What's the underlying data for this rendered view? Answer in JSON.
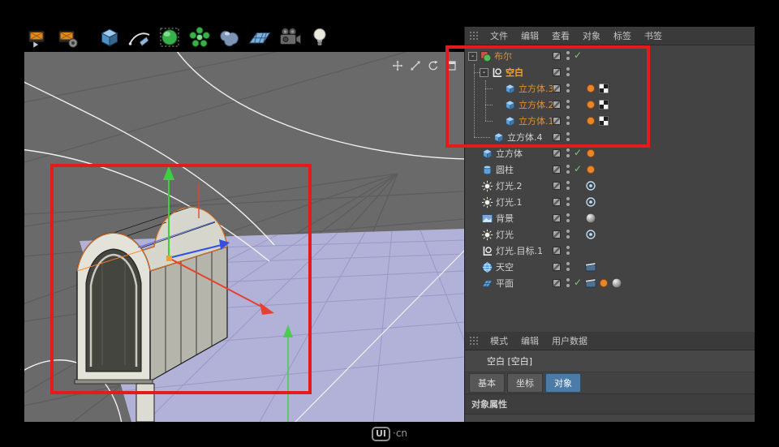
{
  "colors": {
    "annotation": "#e51b1b",
    "selected-orange": "#ffa21e",
    "object-orange": "#e0913c",
    "axis-x": "#e8402e",
    "axis-y": "#3ecf3e",
    "axis-z": "#3450e0",
    "floor-purple": "#b2b1d8",
    "tab-active": "#4d7ba8"
  },
  "toolbar": {
    "icons": [
      {
        "id": "render-view",
        "name": "render-view-icon",
        "glyph": "render1",
        "gap_after": false
      },
      {
        "id": "render-settings",
        "name": "render-settings-icon",
        "glyph": "render2",
        "gap_after": true
      },
      {
        "id": "cube",
        "name": "cube-tool-icon",
        "glyph": "cube",
        "gap_after": false
      },
      {
        "id": "pen",
        "name": "pen-tool-icon",
        "glyph": "pen",
        "gap_after": false
      },
      {
        "id": "subdivision",
        "name": "subdivision-surface-icon",
        "glyph": "subdiv",
        "gap_after": false
      },
      {
        "id": "array",
        "name": "array-tool-icon",
        "glyph": "array",
        "gap_after": false
      },
      {
        "id": "metaball",
        "name": "metaball-tool-icon",
        "glyph": "metaball",
        "gap_after": false
      },
      {
        "id": "floor",
        "name": "floor-tool-icon",
        "glyph": "floor",
        "gap_after": false
      },
      {
        "id": "camera",
        "name": "camera-tool-icon",
        "glyph": "camera",
        "gap_after": false
      },
      {
        "id": "light",
        "name": "light-tool-icon",
        "glyph": "bulb",
        "gap_after": false
      }
    ]
  },
  "viewport": {
    "controls": [
      {
        "id": "pan",
        "name": "pan-view-icon",
        "glyph": "pan"
      },
      {
        "id": "zoom",
        "name": "zoom-view-icon",
        "glyph": "zoom"
      },
      {
        "id": "rotate",
        "name": "rotate-view-icon",
        "glyph": "rotate"
      },
      {
        "id": "maximize",
        "name": "maximize-view-icon",
        "glyph": "maximize"
      }
    ]
  },
  "object_manager": {
    "menu_items": [
      {
        "id": "file",
        "label": "文件"
      },
      {
        "id": "edit",
        "label": "编辑"
      },
      {
        "id": "view",
        "label": "查看"
      },
      {
        "id": "objects",
        "label": "对象"
      },
      {
        "id": "tags",
        "label": "标签"
      },
      {
        "id": "bookmarks",
        "label": "书签"
      }
    ],
    "rows": [
      {
        "id": "boole",
        "label": "布尔",
        "depth": 0,
        "icon": "boole",
        "style": "orange",
        "expander": true,
        "state": "check",
        "tags": []
      },
      {
        "id": "null",
        "label": "空白",
        "depth": 1,
        "icon": "null",
        "style": "selected",
        "expander": true,
        "state": null,
        "tags": []
      },
      {
        "id": "cube-3",
        "label": "立方体.3",
        "depth": 2,
        "icon": "cube",
        "style": "orange",
        "expander": false,
        "state": null,
        "tags": [
          "dot",
          "checker"
        ]
      },
      {
        "id": "cube-2",
        "label": "立方体.2",
        "depth": 2,
        "icon": "cube",
        "style": "orange",
        "expander": false,
        "state": null,
        "tags": [
          "dot",
          "checker"
        ]
      },
      {
        "id": "cube-1",
        "label": "立方体.1",
        "depth": 2,
        "icon": "cube",
        "style": "orange",
        "expander": false,
        "state": null,
        "tags": [
          "dot",
          "checker"
        ]
      },
      {
        "id": "cube-4",
        "label": "立方体.4",
        "depth": 1,
        "icon": "cube",
        "style": "normal",
        "expander": false,
        "state": null,
        "tags": []
      },
      {
        "id": "cube",
        "label": "立方体",
        "depth": 0,
        "icon": "cube",
        "style": "normal",
        "expander": false,
        "state": "check",
        "tags": [
          "dot"
        ]
      },
      {
        "id": "cylinder",
        "label": "圆柱",
        "depth": 0,
        "icon": "cylinder",
        "style": "normal",
        "expander": false,
        "state": "check",
        "tags": [
          "dot"
        ]
      },
      {
        "id": "light-2",
        "label": "灯光.2",
        "depth": 0,
        "icon": "light",
        "style": "normal",
        "expander": false,
        "state": null,
        "tags": [
          "target"
        ]
      },
      {
        "id": "light-1",
        "label": "灯光.1",
        "depth": 0,
        "icon": "light",
        "style": "normal",
        "expander": false,
        "state": null,
        "tags": [
          "target"
        ]
      },
      {
        "id": "background",
        "label": "背景",
        "depth": 0,
        "icon": "background",
        "style": "normal",
        "expander": false,
        "state": null,
        "tags": [
          "sphere"
        ]
      },
      {
        "id": "light",
        "label": "灯光",
        "depth": 0,
        "icon": "light",
        "style": "normal",
        "expander": false,
        "state": null,
        "tags": [
          "target"
        ]
      },
      {
        "id": "light-target-1",
        "label": "灯光.目标.1",
        "depth": 0,
        "icon": "null",
        "style": "normal",
        "expander": false,
        "state": null,
        "tags": []
      },
      {
        "id": "sky",
        "label": "天空",
        "depth": 0,
        "icon": "sky",
        "style": "normal",
        "expander": false,
        "state": null,
        "tags": [
          "film"
        ]
      },
      {
        "id": "plane",
        "label": "平面",
        "depth": 0,
        "icon": "plane",
        "style": "normal",
        "expander": false,
        "state": "check",
        "tags": [
          "film",
          "dot",
          "sphere"
        ]
      }
    ]
  },
  "attributes": {
    "menu_items": [
      {
        "id": "mode",
        "label": "模式"
      },
      {
        "id": "edit",
        "label": "编辑"
      },
      {
        "id": "user-data",
        "label": "用户数据"
      }
    ],
    "object_label": "空白 [空白]",
    "tabs": [
      {
        "id": "basic",
        "label": "基本",
        "active": false
      },
      {
        "id": "coordinates",
        "label": "坐标",
        "active": false
      },
      {
        "id": "object",
        "label": "对象",
        "active": true
      }
    ],
    "section_title": "对象属性"
  },
  "watermark": {
    "logo": "UI",
    "suffix": "·cn"
  }
}
